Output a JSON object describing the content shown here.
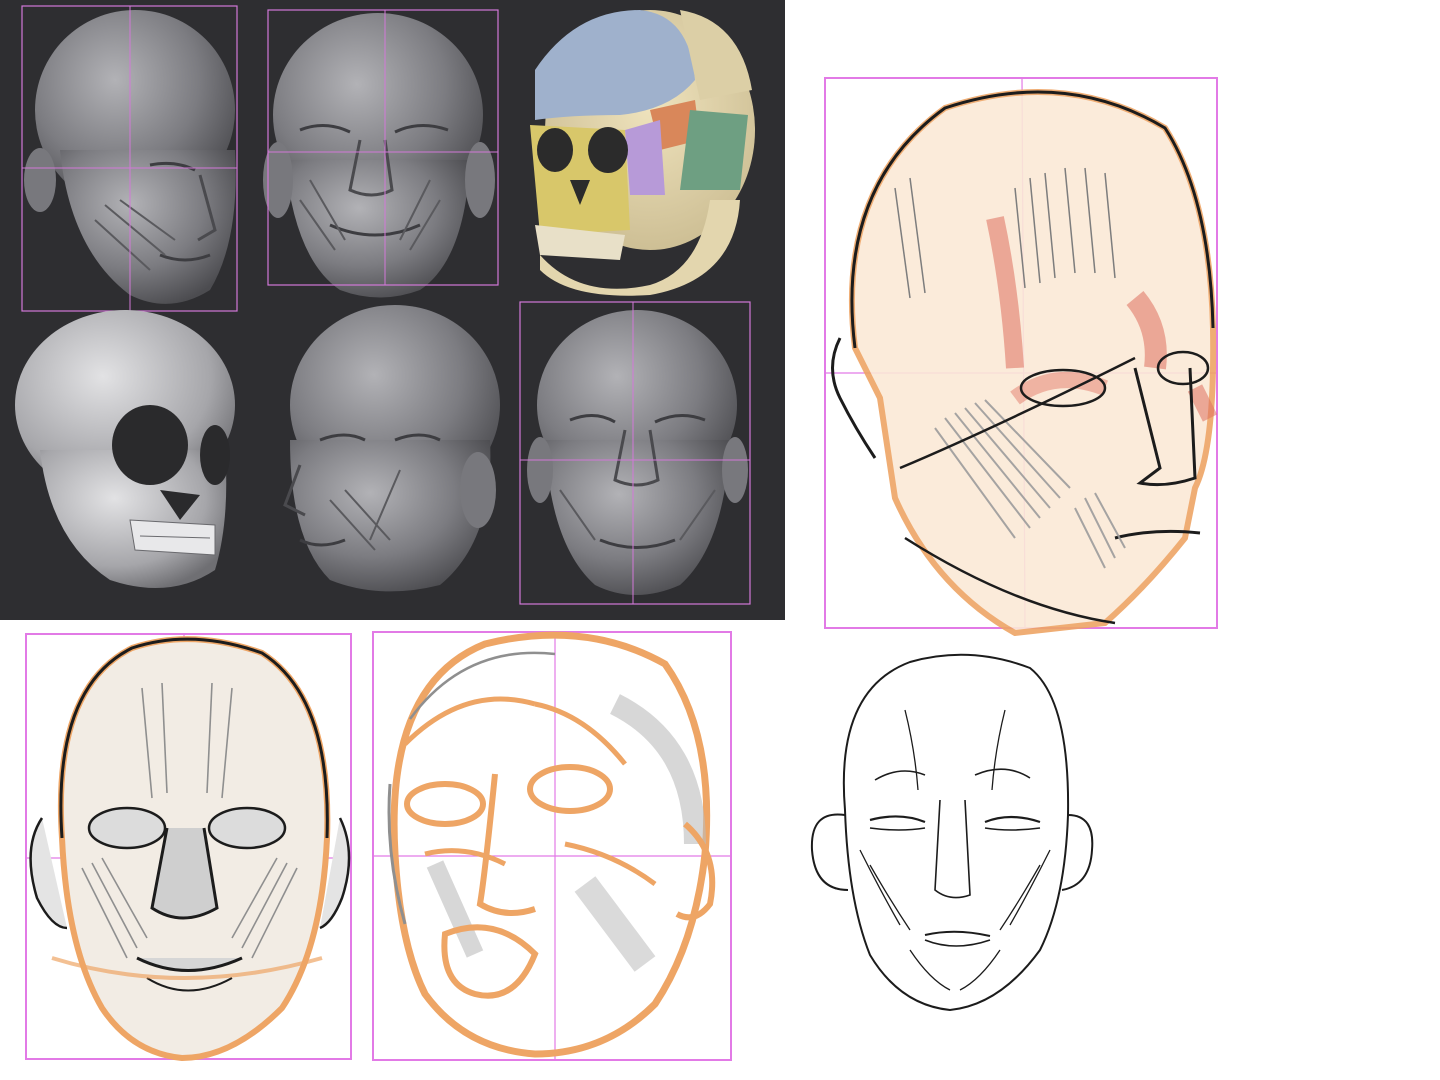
{
  "reference_panel": {
    "watermark_text": "",
    "colors": {
      "background": "#2e2e31",
      "guide": "#d278d8",
      "sculpt": "#8a8a8f",
      "skull_frontal": "#9fb1cc",
      "skull_maxilla": "#d8c76a",
      "skull_zygomatic": "#b79ad8",
      "skull_temporal": "#6e9f82",
      "skull_sphenoid": "#d9875a",
      "skull_bone": "#dccfa6"
    },
    "thumbnails": [
      {
        "subject": "ecorche-head-three-quarter-left"
      },
      {
        "subject": "ecorche-head-front"
      },
      {
        "subject": "colored-skull"
      },
      {
        "subject": "skull-three-quarter"
      },
      {
        "subject": "ecorche-head-three-quarter-right"
      },
      {
        "subject": "ecorche-head-front-lower"
      }
    ]
  },
  "sketches": {
    "colors": {
      "ink": "#1c1c1c",
      "orange": "#eea565",
      "pink_guide": "#e27ae6",
      "red_accent": "#df6f5e",
      "gray_shade": "#9c9c9c"
    },
    "items": [
      {
        "name": "sketch-three-quarter-colored"
      },
      {
        "name": "sketch-front-shaded"
      },
      {
        "name": "sketch-three-quarter-orange-underdrawing"
      },
      {
        "name": "sketch-front-lineart"
      }
    ]
  }
}
